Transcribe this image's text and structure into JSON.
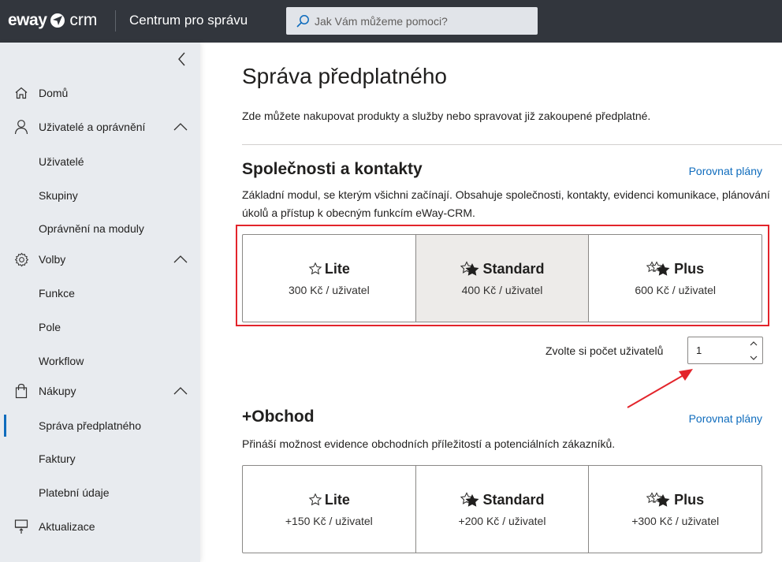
{
  "header": {
    "logo_left": "eway",
    "logo_right": "crm",
    "app_title": "Centrum pro správu",
    "search_placeholder": "Jak Vám můžeme pomoci?"
  },
  "sidebar": {
    "collapse_icon": "chevron-left-icon",
    "items": [
      {
        "label": "Domů",
        "icon": "home-icon"
      },
      {
        "label": "Uživatelé a oprávnění",
        "icon": "person-icon",
        "expanded": true
      },
      {
        "label": "Uživatelé"
      },
      {
        "label": "Skupiny"
      },
      {
        "label": "Oprávnění na moduly"
      },
      {
        "label": "Volby",
        "icon": "gear-icon",
        "expanded": true
      },
      {
        "label": "Funkce"
      },
      {
        "label": "Pole"
      },
      {
        "label": "Workflow"
      },
      {
        "label": "Nákupy",
        "icon": "shopping-bag-icon",
        "expanded": true
      },
      {
        "label": "Správa předplatného",
        "active": true
      },
      {
        "label": "Faktury"
      },
      {
        "label": "Platební údaje"
      },
      {
        "label": "Aktualizace",
        "icon": "update-icon"
      }
    ]
  },
  "main": {
    "title": "Správa předplatného",
    "description": "Zde můžete nakupovat produkty a služby nebo spravovat již zakoupené předplatné.",
    "sections": [
      {
        "title": "Společnosti a kontakty",
        "compare_link": "Porovnat plány",
        "description": "Základní modul, se kterým všichni začínají. Obsahuje společnosti, kontakty, evidenci komunikace, plánování úkolů a přístup k obecným funkcím eWay-CRM.",
        "plans": [
          {
            "name": "Lite",
            "price": "300 Kč / uživatel",
            "selected": false
          },
          {
            "name": "Standard",
            "price": "400 Kč / uživatel",
            "selected": true
          },
          {
            "name": "Plus",
            "price": "600 Kč / uživatel",
            "selected": false
          }
        ],
        "user_count_label": "Zvolte si počet uživatelů",
        "user_count_value": "1"
      },
      {
        "title": "+Obchod",
        "compare_link": "Porovnat plány",
        "description": "Přináší možnost evidence obchodních příležitostí a potenciálních zákazníků.",
        "plans": [
          {
            "name": "Lite",
            "price": "+150 Kč / uživatel",
            "selected": false
          },
          {
            "name": "Standard",
            "price": "+200 Kč / uživatel",
            "selected": false
          },
          {
            "name": "Plus",
            "price": "+300 Kč / uživatel",
            "selected": false
          }
        ]
      }
    ]
  },
  "colors": {
    "topbar": "#32363d",
    "sidebar": "#e8ebef",
    "accent": "#0f6cbd",
    "annotation": "#e3242b",
    "selected_plan": "#edebe9"
  }
}
